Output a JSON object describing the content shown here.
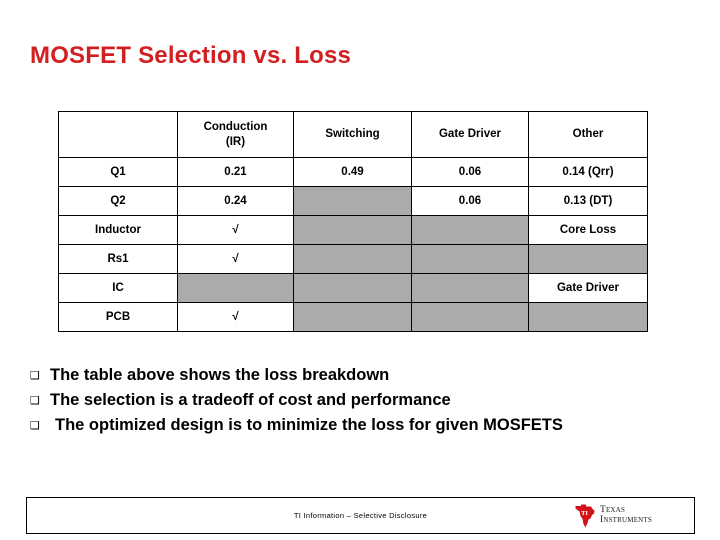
{
  "slide": {
    "title": "MOSFET Selection vs. Loss"
  },
  "table": {
    "columns": [
      "",
      "Conduction\n(IR)",
      "Switching",
      "Gate Driver",
      "Other"
    ],
    "header": {
      "corner": "",
      "conduction_line1": "Conduction",
      "conduction_line2": "(IR)",
      "switching": "Switching",
      "gate_driver": "Gate Driver",
      "other": "Other"
    },
    "rows": [
      {
        "label": "Q1",
        "conduction": "0.21",
        "switching": "0.49",
        "gate_driver": "0.06",
        "other": "0.14 (Qrr)"
      },
      {
        "label": "Q2",
        "conduction": "0.24",
        "switching": "",
        "gate_driver": "0.06",
        "other": "0.13 (DT)"
      },
      {
        "label": "Inductor",
        "conduction": "√",
        "switching": "",
        "gate_driver": "",
        "other": "Core Loss"
      },
      {
        "label": "Rs1",
        "conduction": "√",
        "switching": "",
        "gate_driver": "",
        "other": ""
      },
      {
        "label": "IC",
        "conduction": "",
        "switching": "",
        "gate_driver": "",
        "other": "Gate Driver"
      },
      {
        "label": "PCB",
        "conduction": "√",
        "switching": "",
        "gate_driver": "",
        "other": ""
      }
    ]
  },
  "bullets": [
    {
      "marker": "❑",
      "text": "The table above shows the loss breakdown"
    },
    {
      "marker": "❑",
      "text": "The selection is a tradeoff of cost and performance"
    },
    {
      "marker": "❑",
      "text": "The optimized design is to minimize the loss for given MOSFETS"
    }
  ],
  "footer": {
    "note": "TI Information – Selective Disclosure",
    "logo": {
      "monogram": "TI",
      "line1": "Texas",
      "line2": "Instruments",
      "color": "#D4101A"
    }
  },
  "colors": {
    "title_red": "#D21F1F",
    "cell_gray": "#ABABAB",
    "border_black": "#000000",
    "ti_red": "#D4101A"
  }
}
